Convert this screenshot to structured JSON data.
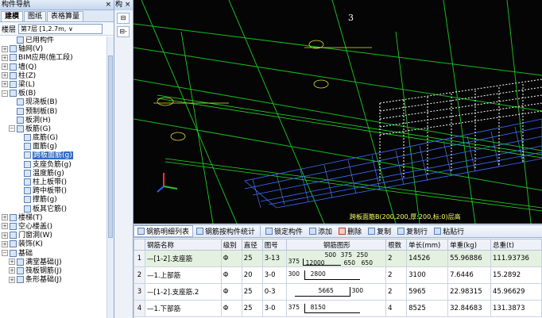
{
  "nav": {
    "title": "构件导航",
    "close_glyph": "×",
    "tabs": [
      "建模",
      "图纸",
      "表格算量"
    ],
    "layer_label": "楼层",
    "layer_value": "第7层 [1,2.7m, ∨"
  },
  "mid": {
    "title": "构 ×",
    "btn1": "⊟",
    "btn2": "⊟-"
  },
  "tree": [
    {
      "label": "已用构件",
      "indent": 1,
      "exp": ""
    },
    {
      "label": "轴网(V)",
      "indent": 0,
      "exp": "+"
    },
    {
      "label": "BIM应用(施工段)",
      "indent": 0,
      "exp": "+"
    },
    {
      "label": "墙(Q)",
      "indent": 0,
      "exp": "+"
    },
    {
      "label": "柱(Z)",
      "indent": 0,
      "exp": "+"
    },
    {
      "label": "梁(L)",
      "indent": 0,
      "exp": "+"
    },
    {
      "label": "板(B)",
      "indent": 0,
      "exp": "−"
    },
    {
      "label": "现浇板(B)",
      "indent": 1,
      "exp": ""
    },
    {
      "label": "预制板(B)",
      "indent": 1,
      "exp": ""
    },
    {
      "label": "板洞(H)",
      "indent": 1,
      "exp": ""
    },
    {
      "label": "板筋(G)",
      "indent": 1,
      "exp": "−"
    },
    {
      "label": "底筋(G)",
      "indent": 2,
      "exp": ""
    },
    {
      "label": "面筋(g)",
      "indent": 2,
      "exp": ""
    },
    {
      "label": "跨板面筋(g)",
      "indent": 2,
      "exp": "",
      "selected": true
    },
    {
      "label": "支座负筋(g)",
      "indent": 2,
      "exp": ""
    },
    {
      "label": "温度筋(g)",
      "indent": 2,
      "exp": ""
    },
    {
      "label": "柱上板带()",
      "indent": 2,
      "exp": ""
    },
    {
      "label": "跨中板带()",
      "indent": 2,
      "exp": ""
    },
    {
      "label": "撑筋(g)",
      "indent": 2,
      "exp": ""
    },
    {
      "label": "板其它筋()",
      "indent": 2,
      "exp": ""
    },
    {
      "label": "楼梯(T)",
      "indent": 0,
      "exp": "+"
    },
    {
      "label": "空心楼盖()",
      "indent": 0,
      "exp": "+"
    },
    {
      "label": "门窗洞(W)",
      "indent": 0,
      "exp": "+"
    },
    {
      "label": "装饰(K)",
      "indent": 0,
      "exp": "+"
    },
    {
      "label": "基础",
      "indent": 0,
      "exp": "−"
    },
    {
      "label": "满堂基础(J)",
      "indent": 1,
      "exp": "+"
    },
    {
      "label": "筏板钢筋(J)",
      "indent": 1,
      "exp": "+"
    },
    {
      "label": "条形基础(J)",
      "indent": 1,
      "exp": "+"
    }
  ],
  "viewport": {
    "number": "3",
    "note": "跨板面筋B(200,200,厚:200,标:0)层高"
  },
  "toolbar": {
    "tab1": "钢筋明细列表",
    "tab2": "钢筋按构件统计",
    "lock": "锁定构件",
    "add": "添加",
    "delete": "删除",
    "copy": "复制",
    "copy_row": "复制行",
    "paste_row": "粘贴行"
  },
  "table": {
    "headers": [
      "钢筋名称",
      "级别",
      "直径",
      "图号",
      "钢筋图形",
      "根数",
      "单长(mm)",
      "单重(kg)",
      "总重(t)"
    ],
    "rows": [
      {
        "no": "1",
        "name": "—[1-2].支座筋",
        "grade": "Φ",
        "dia": "25",
        "fig": "3-13",
        "shape": {
          "a": "500",
          "b": "375",
          "c": "250",
          "d": "375",
          "e": "12000",
          "f": "650",
          "g": "650"
        },
        "count": "2",
        "len": "14526",
        "unit": "55.96886",
        "total": "111.93736"
      },
      {
        "no": "2",
        "name": "—1.上部筋",
        "grade": "Φ",
        "dia": "20",
        "fig": "3-0",
        "shape": {
          "a": "300",
          "b": "2800"
        },
        "count": "2",
        "len": "3100",
        "unit": "7.6446",
        "total": "15.2892"
      },
      {
        "no": "3",
        "name": "—[1-2].支座筋.2",
        "grade": "Φ",
        "dia": "25",
        "fig": "0-3",
        "shape": {
          "a": "5665",
          "b": "300"
        },
        "count": "2",
        "len": "5965",
        "unit": "22.98315",
        "total": "45.96629"
      },
      {
        "no": "4",
        "name": "—1.下部筋",
        "grade": "Φ",
        "dia": "25",
        "fig": "3-0",
        "shape": {
          "a": "375",
          "b": "8150"
        },
        "count": "4",
        "len": "8525",
        "unit": "32.84683",
        "total": "131.3873"
      }
    ]
  }
}
